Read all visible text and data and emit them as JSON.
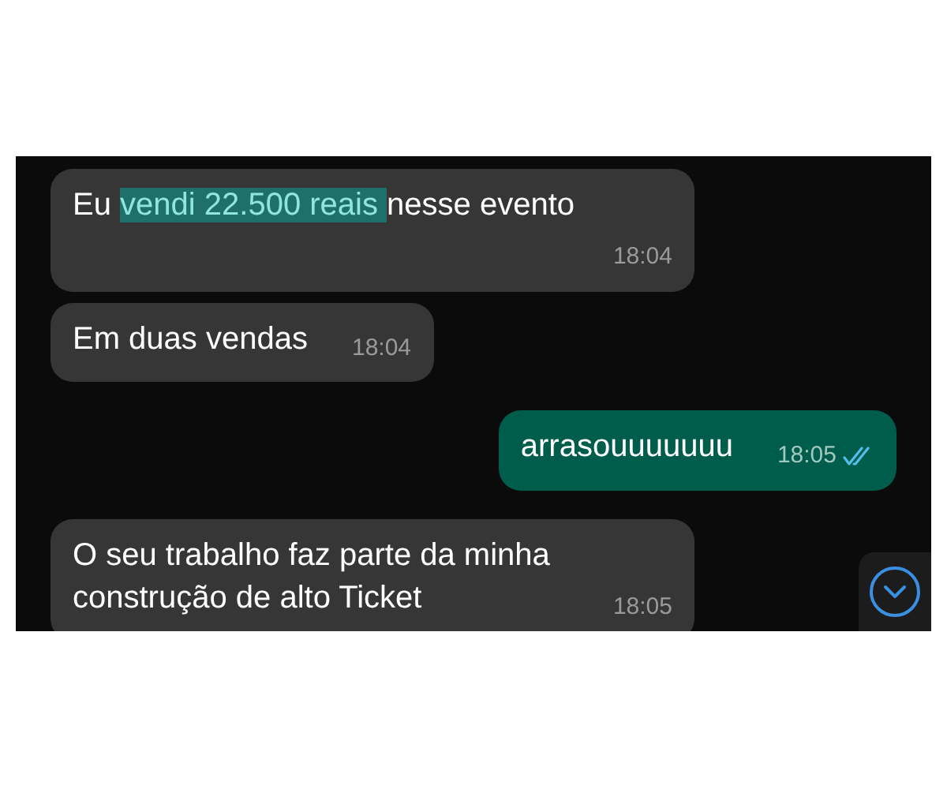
{
  "messages": [
    {
      "outgoing": false,
      "parts": [
        {
          "text": "Eu "
        },
        {
          "text": "vendi 22.500 reais ",
          "highlighted": true
        },
        {
          "text": "nesse evento"
        }
      ],
      "time": "18:04"
    },
    {
      "outgoing": false,
      "parts": [
        {
          "text": "Em duas vendas"
        }
      ],
      "time": "18:04"
    },
    {
      "outgoing": true,
      "parts": [
        {
          "text": "arrasouuuuuuu"
        }
      ],
      "time": "18:05",
      "read": true
    },
    {
      "outgoing": false,
      "parts": [
        {
          "text": "O seu trabalho faz parte da minha construção de alto Ticket"
        }
      ],
      "time": "18:05"
    }
  ]
}
